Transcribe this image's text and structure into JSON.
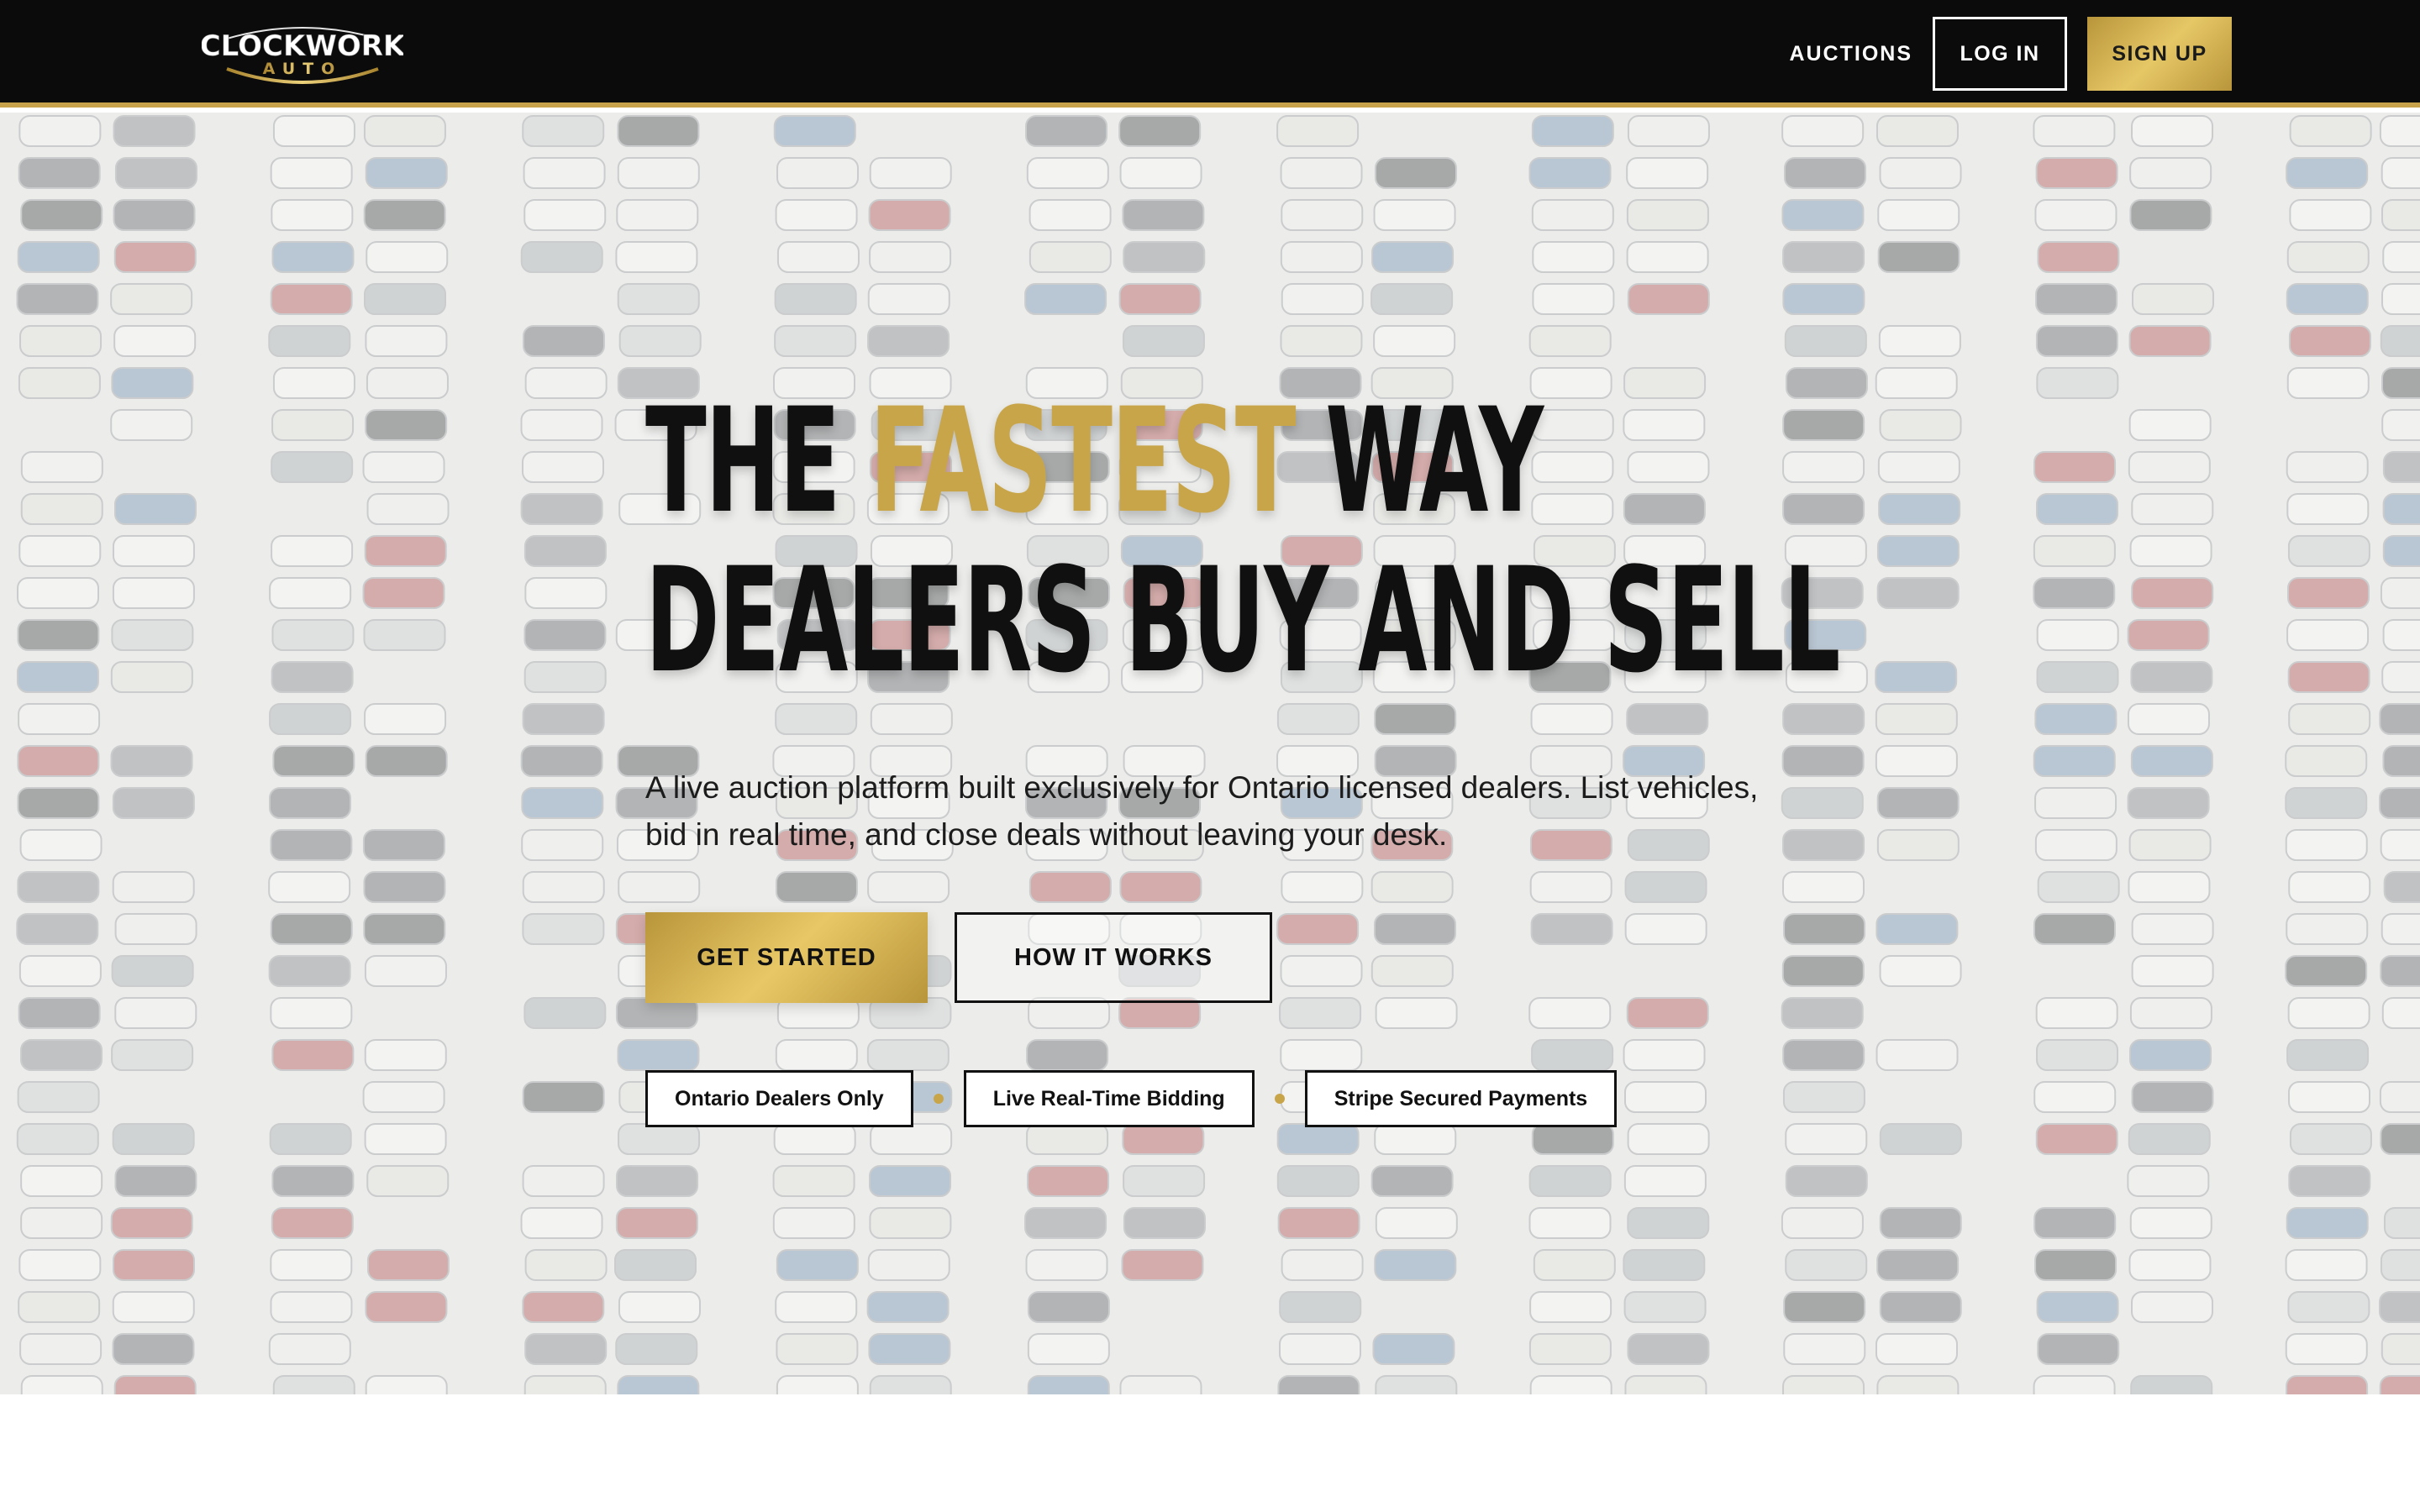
{
  "nav": {
    "logo_top": "CLOCKWORK",
    "logo_bottom": "AUTO",
    "links": {
      "auctions": "AUCTIONS"
    },
    "login_label": "LOG IN",
    "signup_label": "SIGN UP"
  },
  "hero": {
    "headline_part1": "THE ",
    "headline_highlight": "FASTEST",
    "headline_part2": " WAY",
    "headline_line2": "DEALERS BUY AND SELL",
    "subtext": "A live auction platform built exclusively for Ontario licensed dealers. List vehicles, bid in real time, and close deals without leaving your desk.",
    "primary_cta": "GET STARTED",
    "secondary_cta": "HOW IT WORKS",
    "badges": [
      "Ontario Dealers Only",
      "Live Real-Time Bidding",
      "Stripe Secured Payments"
    ]
  },
  "colors": {
    "gold": "#c9a54a",
    "nav_bg": "#0b0b0b",
    "text_dark": "#101010"
  },
  "icons": {
    "logo": "clockwork-auto-logo",
    "separator": "gold-dot"
  }
}
